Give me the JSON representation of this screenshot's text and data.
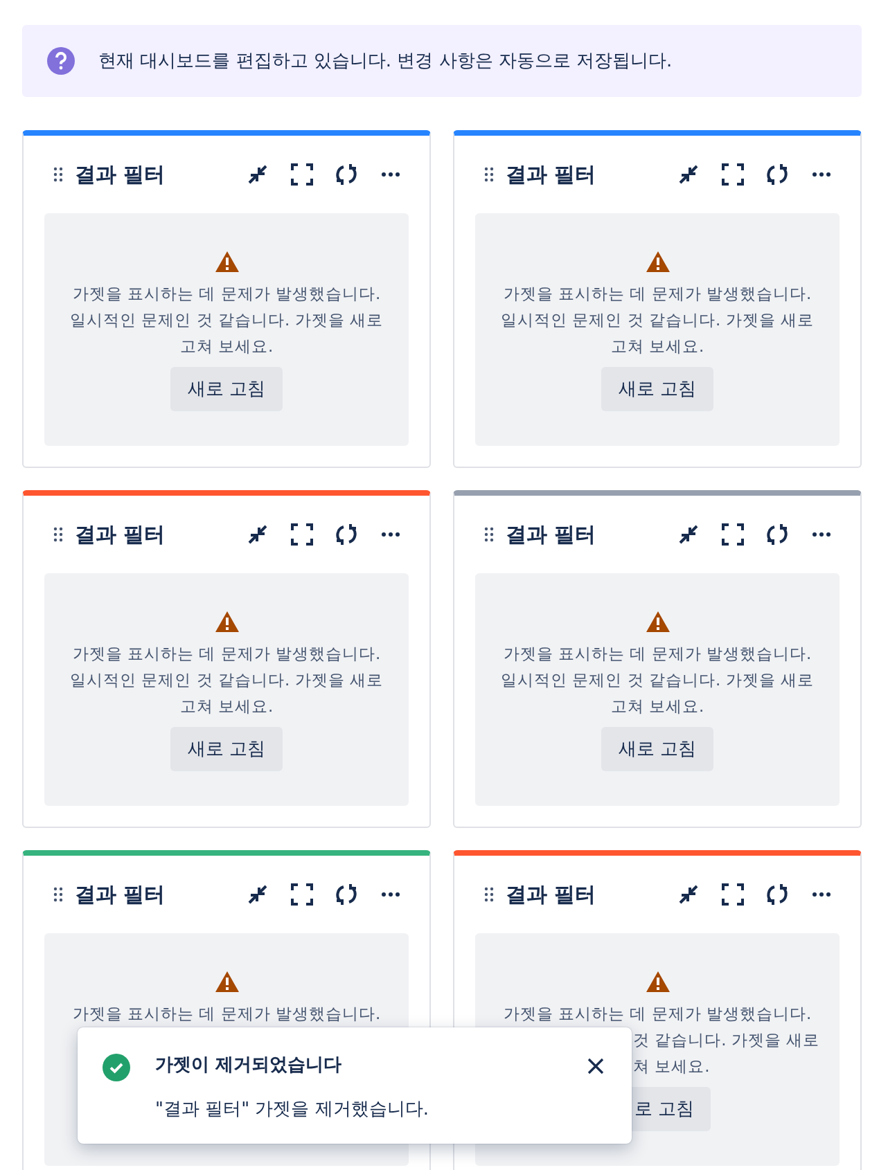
{
  "banner": {
    "text": "현재 대시보드를 편집하고 있습니다. 변경 사항은 자동으로 저장됩니다."
  },
  "gadgets": [
    {
      "title": "결과 필터",
      "color": "#2684ff",
      "message_lines": [
        "가젯을 표시하는 데 문제가 발생했습니다.",
        "일시적인 문제인 것 같습니다. 가젯을 새로",
        "고쳐 보세요."
      ],
      "button": "새로 고침"
    },
    {
      "title": "결과 필터",
      "color": "#2684ff",
      "message_lines": [
        "가젯을 표시하는 데 문제가 발생했습니다.",
        "일시적인 문제인 것 같습니다. 가젯을 새로",
        "고쳐 보세요."
      ],
      "button": "새로 고침"
    },
    {
      "title": "결과 필터",
      "color": "#ff5630",
      "message_lines": [
        "가젯을 표시하는 데 문제가 발생했습니다.",
        "일시적인 문제인 것 같습니다. 가젯을 새로",
        "고쳐 보세요."
      ],
      "button": "새로 고침"
    },
    {
      "title": "결과 필터",
      "color": "#97a0af",
      "message_lines": [
        "가젯을 표시하는 데 문제가 발생했습니다.",
        "일시적인 문제인 것 같습니다. 가젯을 새로",
        "고쳐 보세요."
      ],
      "button": "새로 고침"
    },
    {
      "title": "결과 필터",
      "color": "#36b37e",
      "message_lines": [
        "가젯을 표시하는 데 문제가 발생했습니다."
      ]
    },
    {
      "title": "결과 필터",
      "color": "#ff5630",
      "covered": true,
      "message_lines": [
        "가젯을 표시하는 데 문제가 발생했습니다.",
        "것 같습니다. 가젯을 새로",
        "쳐 보세요."
      ],
      "button": "로 고침"
    }
  ],
  "toast": {
    "title": "가젯이 제거되었습니다",
    "message": "\"결과 필터\" 가젯을 제거했습니다."
  }
}
